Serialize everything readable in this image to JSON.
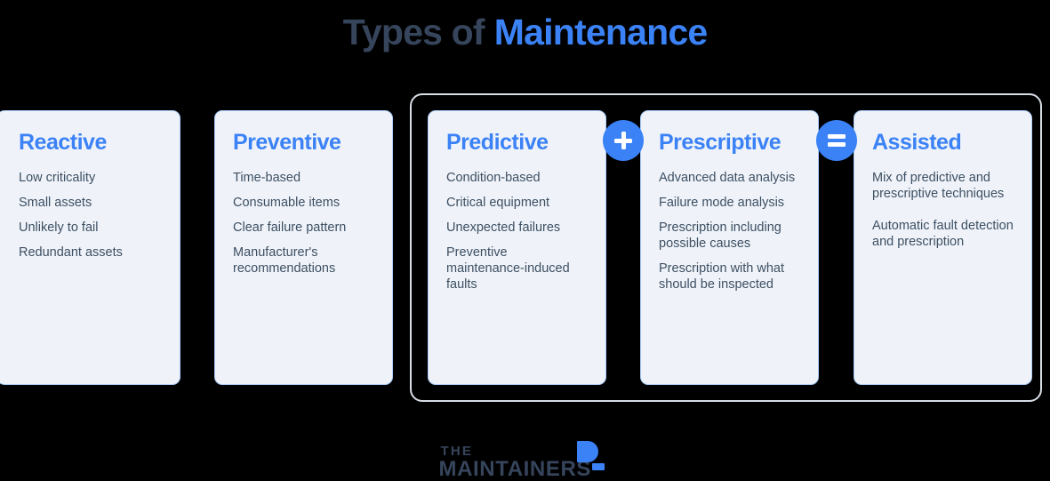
{
  "title": {
    "part_dark": "Types of",
    "part_blue": "Maintenance",
    "color_dark": "#36455c",
    "color_blue": "#3b82f6"
  },
  "theme": {
    "background": "#000000",
    "card_background": "#eff3f9",
    "card_border": "#a9cdfa",
    "heading_color": "#3b82f6",
    "body_text_color": "#3d4f63",
    "frame_border": "#d8dde6",
    "badge_color": "#3b82f6"
  },
  "cards": [
    {
      "id": "reactive",
      "heading": "Reactive",
      "bullets": [
        "Low criticality",
        "Small assets",
        "Unlikely to fail",
        "Redundant assets"
      ]
    },
    {
      "id": "preventive",
      "heading": "Preventive",
      "bullets": [
        "Time-based",
        "Consumable items",
        "Clear failure pattern",
        "Manufacturer's recommendations"
      ]
    },
    {
      "id": "predictive",
      "heading": "Predictive",
      "bullets": [
        "Condition-based",
        "Critical equipment",
        "Unexpected failures",
        "Preventive maintenance-induced faults"
      ]
    },
    {
      "id": "prescriptive",
      "heading": "Prescriptive",
      "bullets": [
        "Advanced data analysis",
        "Failure mode analysis",
        "Prescription including possible causes",
        "Prescription with what should be inspected"
      ]
    },
    {
      "id": "assisted",
      "heading": "Assisted",
      "bullets": [
        "Mix of predictive and prescriptive techniques",
        "Automatic fault detection and prescription"
      ]
    }
  ],
  "badges": [
    {
      "id": "plus",
      "symbol": "+",
      "icon": "plus-icon"
    },
    {
      "id": "equals",
      "symbol": "=",
      "icon": "equals-icon"
    }
  ],
  "logo": {
    "line1": "THE",
    "line2": "MAINTAINERS",
    "mark": "quarter-circle-mark",
    "text_color": "#36455c",
    "mark_color": "#3b82f6"
  }
}
